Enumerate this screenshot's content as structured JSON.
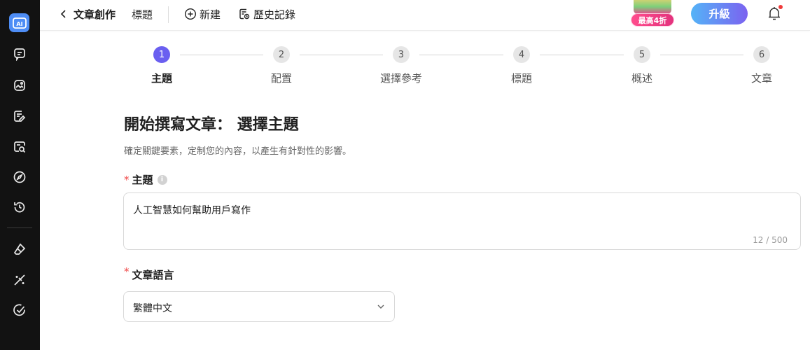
{
  "sidebar": {
    "logo_text": "AI",
    "items": [
      {
        "icon": "chat-icon"
      },
      {
        "icon": "image-icon"
      },
      {
        "icon": "edit-document-icon"
      },
      {
        "icon": "search-review-icon"
      },
      {
        "icon": "compass-icon"
      },
      {
        "icon": "history-icon"
      },
      {
        "icon": "eraser-icon"
      },
      {
        "icon": "magic-pen-icon"
      },
      {
        "icon": "check-circle-icon"
      }
    ]
  },
  "topbar": {
    "title": "文章創作",
    "subtitle": "標題",
    "new_label": "新建",
    "history_label": "歷史記錄",
    "promo_label": "最高4折",
    "upgrade_label": "升級"
  },
  "stepper": {
    "steps": [
      {
        "number": "1",
        "label": "主題",
        "active": true
      },
      {
        "number": "2",
        "label": "配置",
        "active": false
      },
      {
        "number": "3",
        "label": "選擇參考",
        "active": false
      },
      {
        "number": "4",
        "label": "標題",
        "active": false
      },
      {
        "number": "5",
        "label": "概述",
        "active": false
      },
      {
        "number": "6",
        "label": "文章",
        "active": false
      }
    ]
  },
  "form": {
    "title": "開始撰寫文章： 選擇主題",
    "description": "確定關鍵要素，定制您的內容，以產生有針對性的影響。",
    "required_mark": "*",
    "topic": {
      "label": "主題",
      "value": "人工智慧如何幫助用戶寫作",
      "count": "12 / 500"
    },
    "language": {
      "label": "文章語言",
      "value": "繁體中文"
    }
  },
  "colors": {
    "accent": "#6a5ff0",
    "sidebar_bg": "#121212",
    "required": "#f04a4a"
  }
}
